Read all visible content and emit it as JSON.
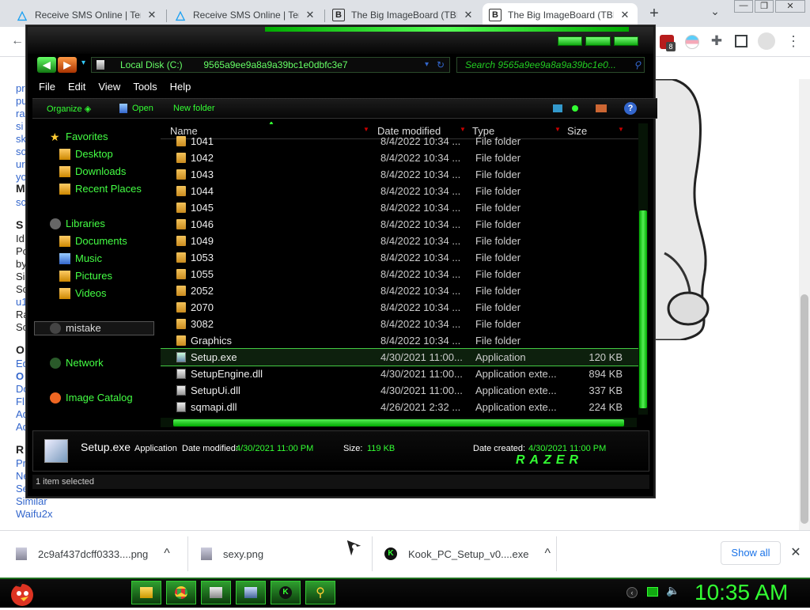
{
  "browser": {
    "tabs": [
      {
        "title": "Receive SMS Online | Temp",
        "icon": "triangle-icon"
      },
      {
        "title": "Receive SMS Online | Temp",
        "icon": "triangle-icon"
      },
      {
        "title": "The Big ImageBoard (TBIB)",
        "icon": "b-icon"
      },
      {
        "title": "The Big ImageBoard (TBIB)",
        "icon": "b-icon"
      }
    ],
    "close_glyph": "✕",
    "new_tab": "+",
    "dropdown": "⌄",
    "win_min": "—",
    "win_max": "❐",
    "win_close": "✕",
    "back": "←",
    "ext_badge": "8"
  },
  "page": {
    "links_top": [
      "pr",
      "pu",
      "ra",
      "si",
      "sk",
      "so",
      "ur",
      "yo"
    ],
    "bold1": "M",
    "link_sc": "sc",
    "bold2": "S",
    "text_lines": [
      "Id",
      "Po",
      "by",
      "Si",
      "Sc"
    ],
    "link_u1": "u1",
    "text_lines2": [
      "Ra",
      "Sc"
    ],
    "bold3": "O",
    "links_mid": [
      "Ed"
    ],
    "link_o": "O",
    "links_mid2": [
      "Do",
      "Fl",
      "Ad",
      "Ad"
    ],
    "bold4": "R",
    "links_bottom": [
      "Pr",
      "Ne",
      "Se"
    ],
    "link_similar": "Similar",
    "link_waifu": "Waifu2x"
  },
  "explorer": {
    "address_drive": "Local Disk (C:)",
    "address_folder": "9565a9ee9a8a9a39bc1e0dbfc3e7",
    "search_placeholder": "Search 9565a9ee9a8a9a39bc1e0...",
    "menus": [
      "File",
      "Edit",
      "View",
      "Tools",
      "Help"
    ],
    "commands": {
      "organize": "Organize ◈",
      "open": "Open",
      "new_folder": "New folder"
    },
    "nav": {
      "favorites": "Favorites",
      "desktop": "Desktop",
      "downloads": "Downloads",
      "recent": "Recent Places",
      "libraries": "Libraries",
      "documents": "Documents",
      "music": "Music",
      "pictures": "Pictures",
      "videos": "Videos",
      "mistake": "mistake",
      "network": "Network",
      "image_catalog": "Image Catalog"
    },
    "columns": {
      "name": "Name",
      "date": "Date modified",
      "type": "Type",
      "size": "Size"
    },
    "files": [
      {
        "name": "1041",
        "date": "8/4/2022 10:34 ...",
        "type": "File folder",
        "size": "",
        "kind": "folder"
      },
      {
        "name": "1042",
        "date": "8/4/2022 10:34 ...",
        "type": "File folder",
        "size": "",
        "kind": "folder"
      },
      {
        "name": "1043",
        "date": "8/4/2022 10:34 ...",
        "type": "File folder",
        "size": "",
        "kind": "folder"
      },
      {
        "name": "1044",
        "date": "8/4/2022 10:34 ...",
        "type": "File folder",
        "size": "",
        "kind": "folder"
      },
      {
        "name": "1045",
        "date": "8/4/2022 10:34 ...",
        "type": "File folder",
        "size": "",
        "kind": "folder"
      },
      {
        "name": "1046",
        "date": "8/4/2022 10:34 ...",
        "type": "File folder",
        "size": "",
        "kind": "folder"
      },
      {
        "name": "1049",
        "date": "8/4/2022 10:34 ...",
        "type": "File folder",
        "size": "",
        "kind": "folder"
      },
      {
        "name": "1053",
        "date": "8/4/2022 10:34 ...",
        "type": "File folder",
        "size": "",
        "kind": "folder"
      },
      {
        "name": "1055",
        "date": "8/4/2022 10:34 ...",
        "type": "File folder",
        "size": "",
        "kind": "folder"
      },
      {
        "name": "2052",
        "date": "8/4/2022 10:34 ...",
        "type": "File folder",
        "size": "",
        "kind": "folder"
      },
      {
        "name": "2070",
        "date": "8/4/2022 10:34 ...",
        "type": "File folder",
        "size": "",
        "kind": "folder"
      },
      {
        "name": "3082",
        "date": "8/4/2022 10:34 ...",
        "type": "File folder",
        "size": "",
        "kind": "folder"
      },
      {
        "name": "Graphics",
        "date": "8/4/2022 10:34 ...",
        "type": "File folder",
        "size": "",
        "kind": "folder"
      },
      {
        "name": "Setup.exe",
        "date": "4/30/2021 11:00...",
        "type": "Application",
        "size": "120 KB",
        "kind": "app",
        "selected": true
      },
      {
        "name": "SetupEngine.dll",
        "date": "4/30/2021 11:00...",
        "type": "Application exte...",
        "size": "894 KB",
        "kind": "dll"
      },
      {
        "name": "SetupUi.dll",
        "date": "4/30/2021 11:00...",
        "type": "Application exte...",
        "size": "337 KB",
        "kind": "dll"
      },
      {
        "name": "sqmapi.dll",
        "date": "4/26/2021 2:32 ...",
        "type": "Application exte...",
        "size": "224 KB",
        "kind": "dll"
      }
    ],
    "details": {
      "filename": "Setup.exe",
      "type": "Application",
      "date_modified_label": "Date modified:",
      "date_modified": "4/30/2021 11:00 PM",
      "size_label": "Size:",
      "size": "119 KB",
      "date_created_label": "Date created:",
      "date_created": "4/30/2021 11:00 PM",
      "brand": "RAZER"
    },
    "status": "1 item selected"
  },
  "downloads": [
    {
      "name": "2c9af437dcff0333....png",
      "caret": "^"
    },
    {
      "name": "sexy.png",
      "caret": ""
    },
    {
      "name": "Kook_PC_Setup_v0....exe",
      "caret": "^"
    }
  ],
  "show_all": "Show all",
  "dl_close": "✕",
  "clock": "10:35 AM",
  "colors": {
    "accent": "#33ff33",
    "link": "#3366cc",
    "chrome_bg": "#dee1e6"
  }
}
